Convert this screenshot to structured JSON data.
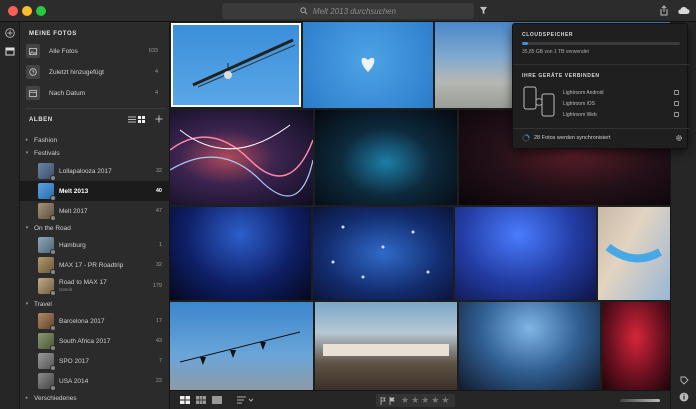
{
  "window": {
    "search_placeholder": "Melt 2013 durchsuchen"
  },
  "library": {
    "title": "MEINE FOTOS",
    "items": [
      {
        "label": "Alle Fotos",
        "count": "633",
        "icon": "photos-icon"
      },
      {
        "label": "Zuletzt hinzugefügt",
        "count": "4",
        "icon": "clock-icon"
      },
      {
        "label": "Nach Datum",
        "count": "4",
        "icon": "calendar-icon"
      }
    ]
  },
  "albums": {
    "title": "ALBEN",
    "folders": [
      {
        "label": "Fashion",
        "state": "collapsed"
      },
      {
        "label": "Festivals",
        "state": "expanded"
      },
      {
        "label": "On the Road",
        "state": "expanded"
      },
      {
        "label": "Travel",
        "state": "expanded"
      },
      {
        "label": "Verschiedenes",
        "state": "collapsed"
      }
    ],
    "items": [
      {
        "label": "Lollapalooza 2017",
        "count": "32",
        "color": "#5c6f8a",
        "selected": false
      },
      {
        "label": "Melt 2013",
        "count": "40",
        "color": "#3e7fb6",
        "selected": true
      },
      {
        "label": "Melt 2017",
        "count": "47",
        "color": "#7a6a5a",
        "selected": false
      },
      {
        "label": "Hamburg",
        "count": "1",
        "color": "#6f8799",
        "selected": false
      },
      {
        "label": "MAX 17 - PR Roadtrip",
        "count": "32",
        "color": "#8a7655",
        "selected": false
      },
      {
        "label": "Road to MAX 17",
        "sub": "Geteilt",
        "count": "179",
        "color": "#9b8a6a",
        "selected": false
      },
      {
        "label": "Barcelona 2017",
        "count": "17",
        "color": "#8a6b4f",
        "selected": false
      },
      {
        "label": "South Africa 2017",
        "count": "43",
        "color": "#6d7a5a",
        "selected": false
      },
      {
        "label": "SPO 2017",
        "count": "7",
        "color": "#7b7b7b",
        "selected": false
      },
      {
        "label": "USA 2014",
        "count": "22",
        "color": "#6a6a6a",
        "selected": false
      }
    ]
  },
  "cloud": {
    "title": "CLOUDSPEICHER",
    "usage": "35,85 GB von 1 TB verwendet",
    "usage_fraction": 0.036,
    "devices_title": "IHRE GERÄTE VERBINDEN",
    "devices": [
      "Lightroom Android",
      "Lightroom iOS",
      "Lightroom Web"
    ],
    "sync_status": "28 Fotos werden synchronisiert"
  },
  "colors": {
    "accent": "#3d8fe0",
    "selected_border": "#ffffff"
  },
  "photos": [
    {
      "bg": "linear-gradient(180deg,#3a8fd9 0%,#5aa7e8 100%)"
    },
    {
      "bg": "radial-gradient(circle at 50% 45%,#4ea3e6 0%,#2a7cc9 100%)"
    },
    {
      "bg": "linear-gradient(180deg,#4a86c9 0%,#7fa9cf 40%,#b6b8b3 70%,#9a9d96 100%)"
    },
    {
      "bg": "radial-gradient(ellipse at 40% 50%,#b04a5a 0%,#3c2450 40%,#0d0d20 100%)"
    },
    {
      "bg": "radial-gradient(ellipse at 50% 55%,#1d7ea8 0%,#0d2a3c 45%,#050810 100%)"
    },
    {
      "bg": "radial-gradient(ellipse at 55% 45%,#5a1d25 0%,#231018 50%,#080608 100%)"
    },
    {
      "bg": "radial-gradient(ellipse at 50% 30%,#2d5ec9 0%,#0e1f66 55%,#05081c 100%)"
    },
    {
      "bg": "radial-gradient(ellipse at 50% 50%,#2f6ac9 0%,#132c6e 60%,#0a143a 100%)"
    },
    {
      "bg": "radial-gradient(ellipse at 45% 30%,#4a7cff 0%,#243ea6 50%,#0d1448 100%)"
    },
    {
      "bg": "linear-gradient(120deg,#c7b9a5 0%,#e2d4c1 40%,#9ab7d6 100%)"
    },
    {
      "bg": "linear-gradient(180deg,#3b86cc 0%,#6aa5d9 60%,#8c9aa6 100%)"
    },
    {
      "bg": "linear-gradient(180deg,#7aa7c9 0%,#b7c7d3 35%,#5e5245 70%,#3a2f28 100%)"
    },
    {
      "bg": "radial-gradient(ellipse at 50% 30%,#7fb6e6 0%,#305e92 50%,#101a2a 100%)"
    },
    {
      "bg": "radial-gradient(ellipse at 50% 40%,#d6263a 0%,#6a1020 55%,#1a0508 100%)"
    }
  ]
}
